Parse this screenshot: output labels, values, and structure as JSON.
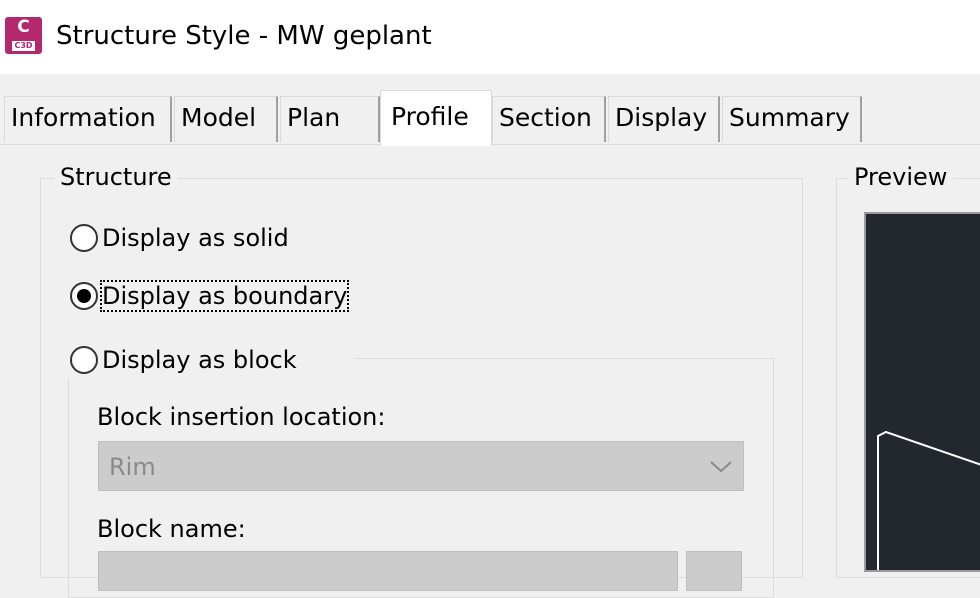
{
  "window": {
    "title": "Structure Style - MW geplant",
    "app_icon_letter": "C",
    "app_icon_sub": "C3D"
  },
  "tabs": [
    {
      "label": "Information",
      "active": false
    },
    {
      "label": "Model",
      "active": false
    },
    {
      "label": "Plan",
      "active": false
    },
    {
      "label": "Profile",
      "active": true
    },
    {
      "label": "Section",
      "active": false
    },
    {
      "label": "Display",
      "active": false
    },
    {
      "label": "Summary",
      "active": false
    }
  ],
  "structure": {
    "group_label": "Structure",
    "options": [
      {
        "label": "Display as solid",
        "checked": false
      },
      {
        "label": "Display as boundary",
        "checked": true
      },
      {
        "label": "Display as block",
        "checked": false
      }
    ],
    "block_insertion_label": "Block insertion location:",
    "block_insertion_value": "Rim",
    "block_name_label": "Block name:"
  },
  "preview": {
    "group_label": "Preview"
  },
  "colors": {
    "accent_icon": "#b3286e",
    "preview_background": "#23272e"
  }
}
